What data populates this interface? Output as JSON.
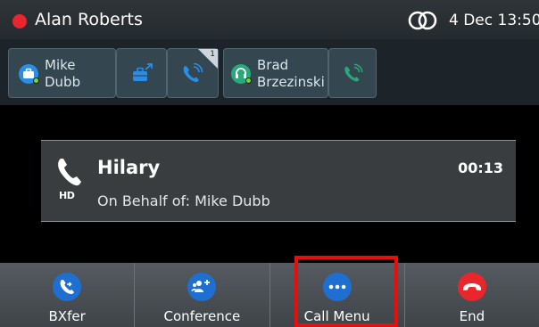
{
  "status": {
    "user_name": "Alan Roberts",
    "presence_color": "#e8262b",
    "date_time": "4 Dec 13:50"
  },
  "line_keys": [
    {
      "label_line1": "Mike",
      "label_line2": "Dubb",
      "icon": "briefcase-icon",
      "presence": "available"
    },
    {
      "icon": "briefcase-transfer-icon"
    },
    {
      "icon": "phone-active-icon",
      "badge": "1"
    },
    {
      "label_line1": "Brad",
      "label_line2": "Brzezinski",
      "icon": "headset-icon",
      "presence": "available"
    },
    {
      "icon": "phone-incoming-icon"
    }
  ],
  "call": {
    "name": "Hilary",
    "timer": "00:13",
    "on_behalf": "On Behalf of: Mike Dubb",
    "hd": "HD"
  },
  "softkeys": [
    {
      "label": "BXfer",
      "icon": "transfer-icon",
      "color": "#1f6fd0"
    },
    {
      "label": "Conference",
      "icon": "conference-icon",
      "color": "#1f6fd0"
    },
    {
      "label": "Call Menu",
      "icon": "more-icon",
      "color": "#1f6fd0",
      "highlighted": true
    },
    {
      "label": "End",
      "icon": "hangup-icon",
      "color": "#e8262b"
    }
  ]
}
